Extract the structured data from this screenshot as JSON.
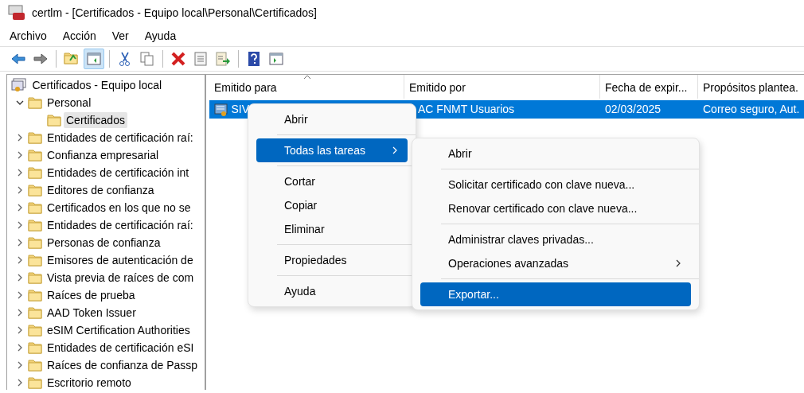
{
  "window": {
    "title": "certlm - [Certificados - Equipo local\\Personal\\Certificados]"
  },
  "menu_bar": [
    "Archivo",
    "Acción",
    "Ver",
    "Ayuda"
  ],
  "toolbar": [
    {
      "kind": "back",
      "pressed": false
    },
    {
      "kind": "forward",
      "pressed": false
    },
    {
      "kind": "separator"
    },
    {
      "kind": "up",
      "pressed": false
    },
    {
      "kind": "console",
      "pressed": true
    },
    {
      "kind": "separator"
    },
    {
      "kind": "cut",
      "pressed": false
    },
    {
      "kind": "copy",
      "pressed": false
    },
    {
      "kind": "separator"
    },
    {
      "kind": "delete",
      "pressed": false
    },
    {
      "kind": "properties",
      "pressed": false
    },
    {
      "kind": "export",
      "pressed": false
    },
    {
      "kind": "separator"
    },
    {
      "kind": "help",
      "pressed": false
    },
    {
      "kind": "pane",
      "pressed": false
    }
  ],
  "tree": [
    {
      "label": "Certificados - Equipo local",
      "kind": "root",
      "children": [
        {
          "label": "Personal",
          "expanded": true,
          "selected": false,
          "children": [
            {
              "label": "Certificados",
              "selected": true
            }
          ]
        },
        {
          "label": "Entidades de certificación raí:",
          "expanded": false,
          "selected": false
        },
        {
          "label": "Confianza empresarial",
          "expanded": false,
          "selected": false
        },
        {
          "label": "Entidades de certificación int",
          "expanded": false,
          "selected": false
        },
        {
          "label": "Editores de confianza",
          "expanded": false,
          "selected": false
        },
        {
          "label": "Certificados en los que no se",
          "expanded": false,
          "selected": false
        },
        {
          "label": "Entidades de certificación raí:",
          "expanded": false,
          "selected": false
        },
        {
          "label": "Personas de confianza",
          "expanded": false,
          "selected": false
        },
        {
          "label": "Emisores de autenticación de",
          "expanded": false,
          "selected": false
        },
        {
          "label": "Vista previa de raíces de com",
          "expanded": false,
          "selected": false
        },
        {
          "label": "Raíces de prueba",
          "expanded": false,
          "selected": false
        },
        {
          "label": "AAD Token Issuer",
          "expanded": false,
          "selected": false
        },
        {
          "label": "eSIM Certification Authorities",
          "expanded": false,
          "selected": false
        },
        {
          "label": "Entidades de certificación eSI",
          "expanded": false,
          "selected": false
        },
        {
          "label": "Raíces de confianza de Passp",
          "expanded": false,
          "selected": false
        },
        {
          "label": "Escritorio remoto",
          "expanded": false,
          "selected": false
        }
      ]
    }
  ],
  "table": {
    "columns": [
      {
        "label": "Emitido para",
        "sorted": true
      },
      {
        "label": "Emitido por",
        "sorted": false
      },
      {
        "label": "Fecha de expir...",
        "sorted": false
      },
      {
        "label": "Propósitos plantea.",
        "sorted": false
      }
    ],
    "rows": [
      {
        "cells": [
          "SIV",
          "AC FNMT Usuarios",
          "02/03/2025",
          "Correo seguro, Aut."
        ],
        "selected": true
      }
    ]
  },
  "context_menu": {
    "items": [
      {
        "kind": "item",
        "label": "Abrir",
        "selected": false,
        "submenu": false
      },
      {
        "kind": "separator"
      },
      {
        "kind": "item",
        "label": "Todas las tareas",
        "selected": true,
        "submenu": true
      },
      {
        "kind": "separator"
      },
      {
        "kind": "item",
        "label": "Cortar",
        "selected": false,
        "submenu": false
      },
      {
        "kind": "item",
        "label": "Copiar",
        "selected": false,
        "submenu": false
      },
      {
        "kind": "item",
        "label": "Eliminar",
        "selected": false,
        "submenu": false
      },
      {
        "kind": "separator"
      },
      {
        "kind": "item",
        "label": "Propiedades",
        "selected": false,
        "submenu": false
      },
      {
        "kind": "separator"
      },
      {
        "kind": "item",
        "label": "Ayuda",
        "selected": false,
        "submenu": false
      }
    ]
  },
  "submenu": {
    "items": [
      {
        "kind": "item",
        "label": "Abrir",
        "selected": false,
        "submenu": false
      },
      {
        "kind": "separator"
      },
      {
        "kind": "item",
        "label": "Solicitar certificado con clave nueva...",
        "selected": false,
        "submenu": false
      },
      {
        "kind": "item",
        "label": "Renovar certificado con clave nueva...",
        "selected": false,
        "submenu": false
      },
      {
        "kind": "separator"
      },
      {
        "kind": "item",
        "label": "Administrar claves privadas...",
        "selected": false,
        "submenu": false
      },
      {
        "kind": "item",
        "label": "Operaciones avanzadas",
        "selected": false,
        "submenu": true
      },
      {
        "kind": "separator"
      },
      {
        "kind": "item",
        "label": "Exportar...",
        "selected": true,
        "submenu": false
      }
    ]
  }
}
